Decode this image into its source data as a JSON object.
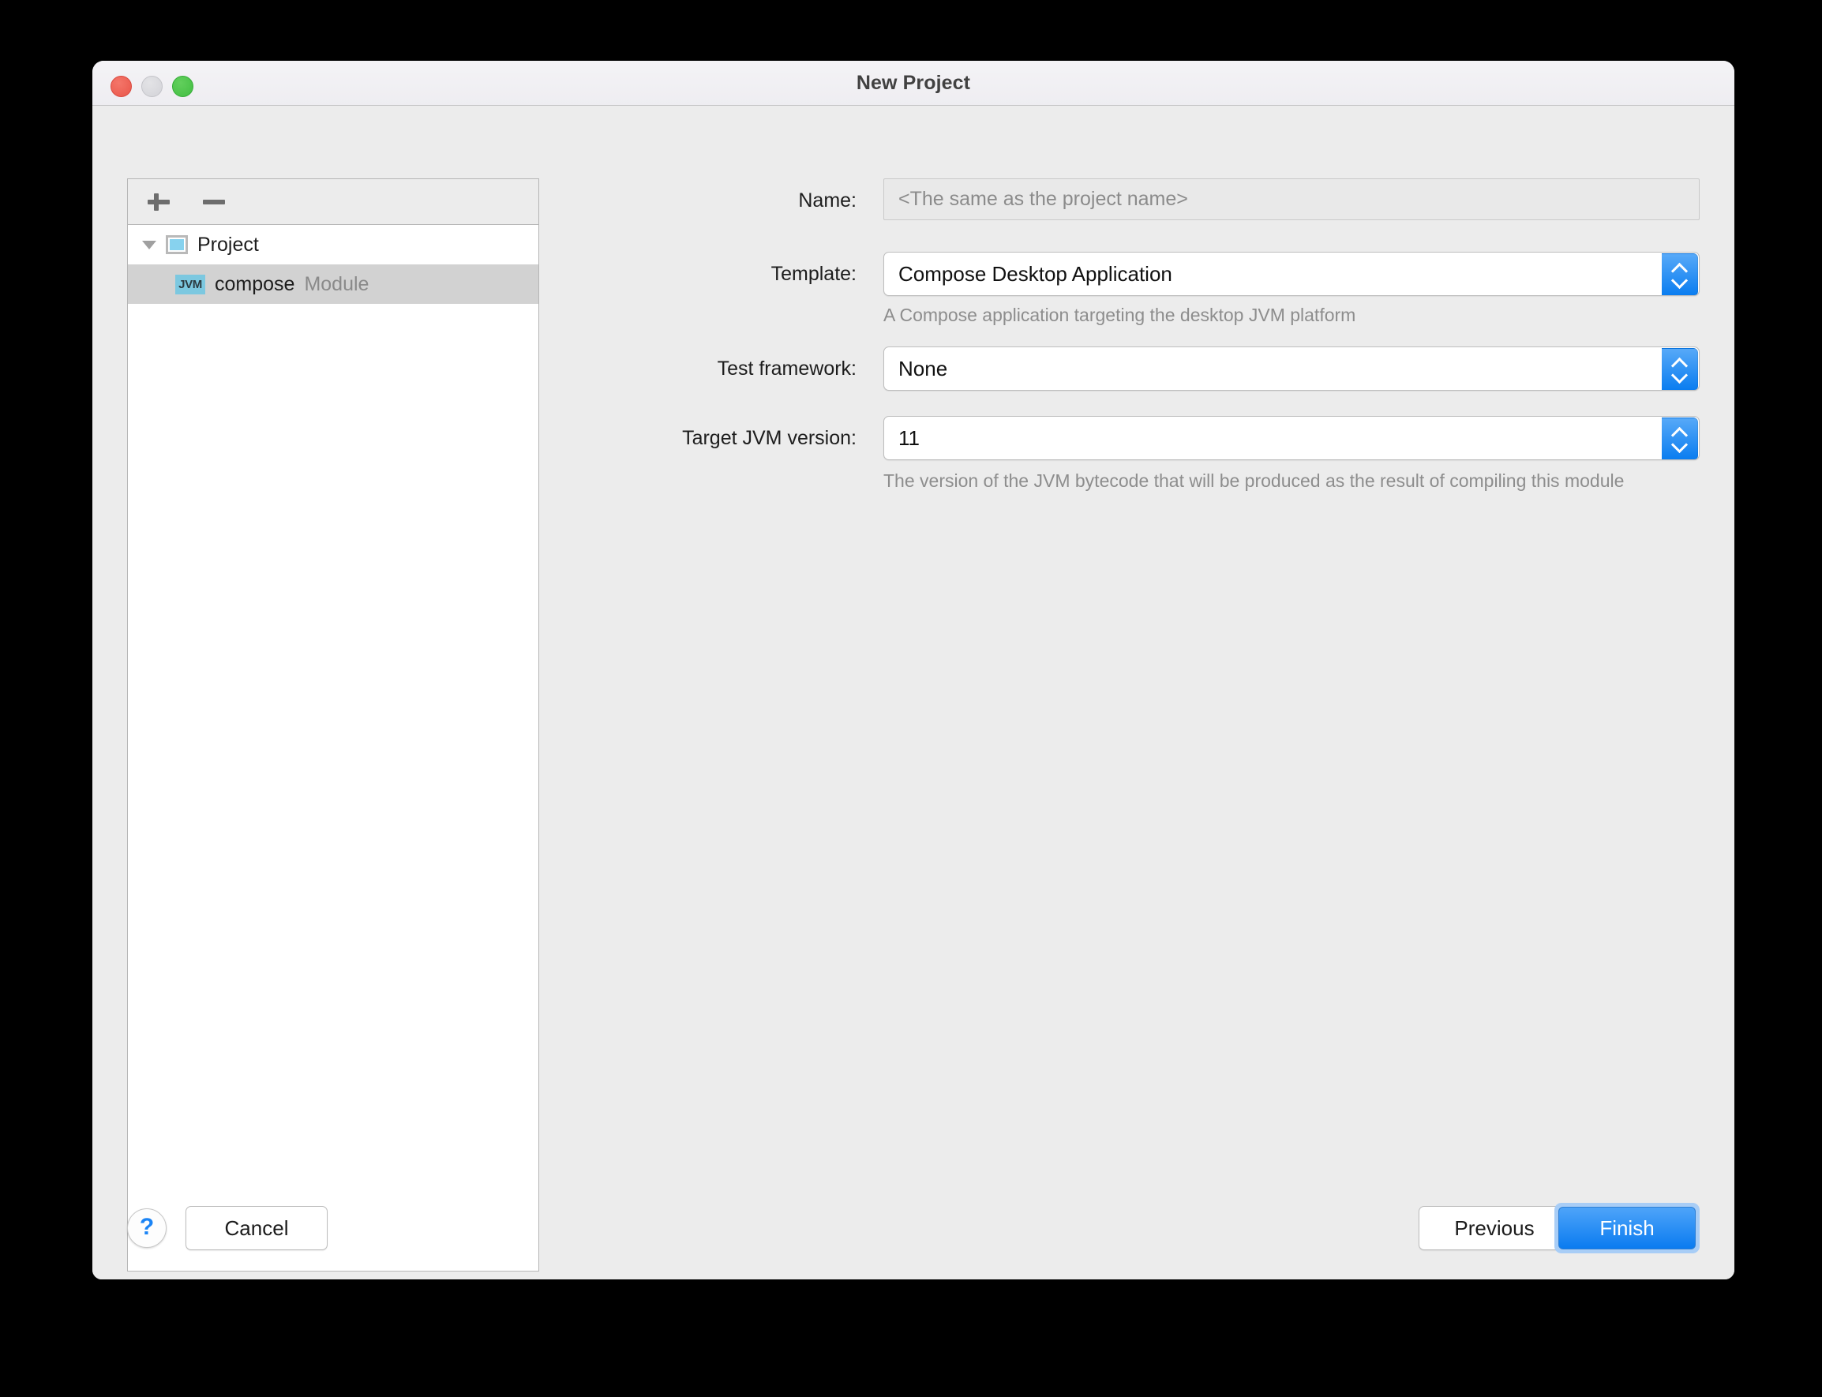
{
  "window": {
    "title": "New Project",
    "traffic_lights": [
      "close-button",
      "minimize-button",
      "zoom-button"
    ]
  },
  "tree_panel": {
    "toolbar": {
      "add_label": "+",
      "remove_label": "−"
    },
    "nodes": [
      {
        "label": "Project",
        "icon": "project-icon",
        "selected": false,
        "expanded": true,
        "tag": ""
      },
      {
        "label": "compose",
        "icon": "jvm-badge-icon",
        "badge_text": "JVM",
        "selected": true,
        "expanded": false,
        "tag": "Module"
      }
    ]
  },
  "form": {
    "name": {
      "label": "Name:",
      "value": "",
      "placeholder": "<The same as the project name>",
      "enabled": false
    },
    "template": {
      "label": "Template:",
      "value": "Compose Desktop Application",
      "hint": "A Compose application targeting the desktop JVM platform"
    },
    "test_framework": {
      "label": "Test framework:",
      "value": "None",
      "hint": ""
    },
    "target_jvm": {
      "label": "Target JVM version:",
      "value": "11",
      "hint": "The version of the JVM bytecode that will be produced as the result of compiling this module"
    }
  },
  "footer": {
    "help_label": "?",
    "cancel_label": "Cancel",
    "previous_label": "Previous",
    "finish_label": "Finish"
  },
  "colors": {
    "accent": "#0a7bf0",
    "window_bg": "#ececec",
    "titlebar_bg": "#f1f0f4",
    "selection": "#d2d2d2",
    "badge": "#7cc8e0",
    "hint_text": "#8d8d8d"
  }
}
